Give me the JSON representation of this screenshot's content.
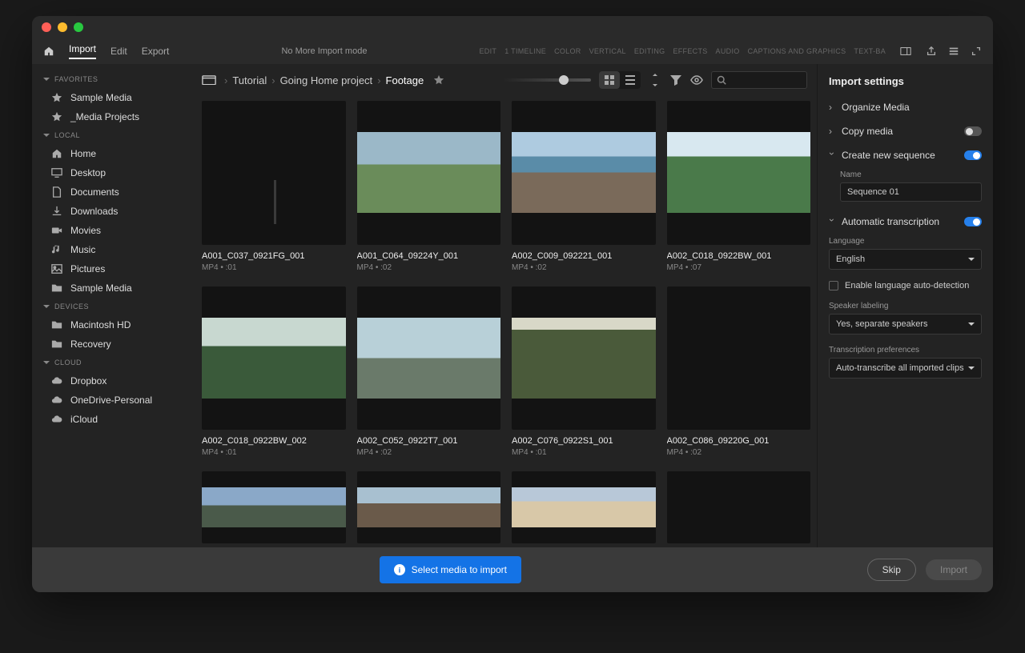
{
  "titlebar": {},
  "topbar": {
    "tabs": [
      "Import",
      "Edit",
      "Export"
    ],
    "center": "No More Import mode",
    "workspaces": [
      "EDIT",
      "1 TIMELINE",
      "COLOR",
      "VERTICAL",
      "EDITING",
      "EFFECTS",
      "AUDIO",
      "CAPTIONS AND GRAPHICS",
      "TEXT-BA"
    ]
  },
  "sidebar": {
    "sections": [
      {
        "title": "FAVORITES",
        "items": [
          {
            "icon": "star",
            "label": "Sample Media"
          },
          {
            "icon": "star",
            "label": "_Media Projects"
          }
        ]
      },
      {
        "title": "LOCAL",
        "items": [
          {
            "icon": "home",
            "label": "Home"
          },
          {
            "icon": "desktop",
            "label": "Desktop"
          },
          {
            "icon": "document",
            "label": "Documents"
          },
          {
            "icon": "download",
            "label": "Downloads"
          },
          {
            "icon": "video",
            "label": "Movies"
          },
          {
            "icon": "music",
            "label": "Music"
          },
          {
            "icon": "picture",
            "label": "Pictures"
          },
          {
            "icon": "folder",
            "label": "Sample Media"
          }
        ]
      },
      {
        "title": "DEVICES",
        "items": [
          {
            "icon": "folder",
            "label": "Macintosh HD"
          },
          {
            "icon": "folder",
            "label": "Recovery"
          }
        ]
      },
      {
        "title": "CLOUD",
        "items": [
          {
            "icon": "cloud",
            "label": "Dropbox"
          },
          {
            "icon": "cloud",
            "label": "OneDrive-Personal"
          },
          {
            "icon": "cloud",
            "label": "iCloud"
          }
        ]
      }
    ]
  },
  "breadcrumb": [
    "Tutorial",
    "Going Home project",
    "Footage"
  ],
  "clips": [
    {
      "name": "A001_C037_0921FG_001",
      "meta": "MP4  •  :01",
      "t": "t1"
    },
    {
      "name": "A001_C064_09224Y_001",
      "meta": "MP4  •  :02",
      "t": "t2"
    },
    {
      "name": "A002_C009_092221_001",
      "meta": "MP4  •  :02",
      "t": "t3"
    },
    {
      "name": "A002_C018_0922BW_001",
      "meta": "MP4  •  :07",
      "t": "t4"
    },
    {
      "name": "A002_C018_0922BW_002",
      "meta": "MP4  •  :01",
      "t": "t5"
    },
    {
      "name": "A002_C052_0922T7_001",
      "meta": "MP4  •  :02",
      "t": "t6"
    },
    {
      "name": "A002_C076_0922S1_001",
      "meta": "MP4  •  :01",
      "t": "t7"
    },
    {
      "name": "A002_C086_09220G_001",
      "meta": "MP4  •  :02",
      "t": "t8"
    },
    {
      "name": "",
      "meta": "",
      "t": "t9"
    },
    {
      "name": "",
      "meta": "",
      "t": "t10"
    },
    {
      "name": "",
      "meta": "",
      "t": "t11"
    },
    {
      "name": "",
      "meta": "",
      "t": "t12"
    }
  ],
  "settings": {
    "title": "Import settings",
    "organize": "Organize Media",
    "copy": "Copy media",
    "create_seq": "Create new sequence",
    "seq_name_label": "Name",
    "seq_name": "Sequence 01",
    "auto_trans": "Automatic transcription",
    "lang_label": "Language",
    "language": "English",
    "auto_detect": "Enable language auto-detection",
    "speaker_label": "Speaker labeling",
    "speaker": "Yes, separate speakers",
    "pref_label": "Transcription preferences",
    "pref": "Auto-transcribe all imported clips"
  },
  "footer": {
    "prompt": "Select media to import",
    "skip": "Skip",
    "import": "Import"
  }
}
